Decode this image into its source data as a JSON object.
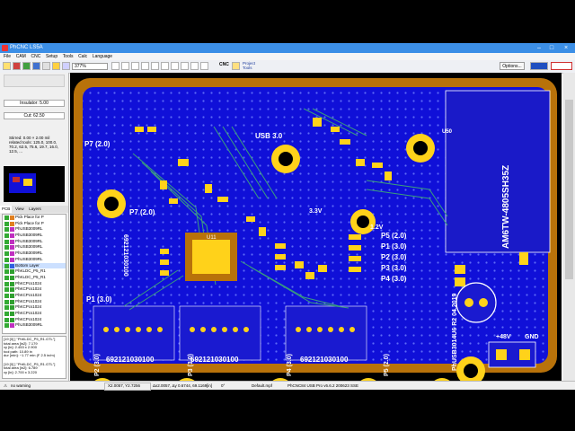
{
  "window": {
    "title": "PhCNC LS5A"
  },
  "menu": [
    "File",
    "CAM",
    "CNC",
    "Setup",
    "Tools",
    "Calc",
    "Language"
  ],
  "toolbar": {
    "zoom": "377%",
    "cnc_label": "CNC",
    "project_tools": "Project Tools",
    "options_label": "Options..."
  },
  "left": {
    "insulator": "Insulator: 5.00",
    "cut": "Cut: 62.50",
    "info_lines": [
      "Stirred: 0.00 × 2.00 mil",
      "related tools: 125.0, 100.0, 70.2, 62.5, 75.6, 19.7, 16.0, 12.5, ..."
    ],
    "tab_pcb": "PCB",
    "tab_view": "View",
    "tab_layers": "Layers"
  },
  "layers": [
    {
      "name": "Pick Place for P",
      "color": "#e08020"
    },
    {
      "name": "Pick Place for P",
      "color": "#e08020"
    },
    {
      "name": "PhUSB3009RL",
      "color": "#c030c0"
    },
    {
      "name": "PhUSB3009RL",
      "color": "#c030c0"
    },
    {
      "name": "PhUSB3009RL",
      "color": "#c030c0"
    },
    {
      "name": "PhUSB3009RL",
      "color": "#c030c0"
    },
    {
      "name": "PhUSB3009RL",
      "color": "#c030c0"
    },
    {
      "name": "PhUSB3009RL",
      "color": "#c030c0"
    },
    {
      "name": "Bottom Layer",
      "color": "#3060e0"
    },
    {
      "name": "PhKLDC_P5_R1",
      "color": "#30a030"
    },
    {
      "name": "PhKLDC_P5_R1",
      "color": "#30a030"
    },
    {
      "name": "PhKCPcs1024",
      "color": "#30a030"
    },
    {
      "name": "PhKCPcs1024",
      "color": "#30a030"
    },
    {
      "name": "PhKCPcs1024",
      "color": "#30a030"
    },
    {
      "name": "PhKCPcs1024",
      "color": "#30a030"
    },
    {
      "name": "PhKCPcs1024",
      "color": "#30a030"
    },
    {
      "name": "PhKCPcs1024",
      "color": "#30a030"
    },
    {
      "name": "PhKCPcs1024",
      "color": "#30a030"
    },
    {
      "name": "PhUSB3009RL",
      "color": "#c030c0"
    }
  ],
  "console": [
    "[19 [0] ] \"PhKLDC_P5_R1.GTL\"]",
    "total area [in2]: 7.179",
    "xy [in]: 2.453 x 2.900",
    "tool path: 10.89 in",
    "dur [min]: ~1.77 min (F 2.5 in/m)",
    "",
    "[19 [0] ] \"PhKLDC_P5_R1.GTL\"]",
    "total area [in2]: 6.789",
    "xy [in]: 2.700 x 3.220"
  ],
  "status": {
    "warning": "no warning",
    "coords": "X2.0057, Y2.7256",
    "delta": "Δx2.0057, Δy 0.6744, 69.1169",
    "in_label": "[in]",
    "angle": "0°",
    "file": "Default.mpf",
    "version": "PhCNC84 USB Pro v6.6.2 200623 SSE"
  },
  "pcb": {
    "labels": {
      "usb": "USB 3.0",
      "p7a": "P7 (2.0)",
      "p7b": "P7 (2.0)",
      "p1": "P1 (3.0)",
      "p2": "P2 (3.0)",
      "p3": "P3 (3.0)",
      "p4": "P4 (3.0)",
      "p5": "P5 (2.0)",
      "p5b": "P5 (2.0)",
      "p1r": "P1 (3.0)",
      "p2r": "P2 (3.0)",
      "p3r": "P3 (3.0)",
      "p4r": "P4 (3.0)",
      "v33": "3.3V",
      "v12": "1.2V",
      "v48": "+48V",
      "gnd": "GND",
      "module": "AM6TW-4805SH35Z",
      "board": "PhUSB3014U6 R2 04.2019",
      "partno1": "692121030100",
      "partno2": "692121030100",
      "partno3": "692121030100",
      "partno_v": "692121030100",
      "u11": "U11",
      "u50": "U50"
    }
  },
  "colors": {
    "board_bg": "#1010d8",
    "copper_top": "#b8720a",
    "pad": "#ffd21a",
    "trace": "#3aa07a",
    "silk": "#ffffff"
  }
}
